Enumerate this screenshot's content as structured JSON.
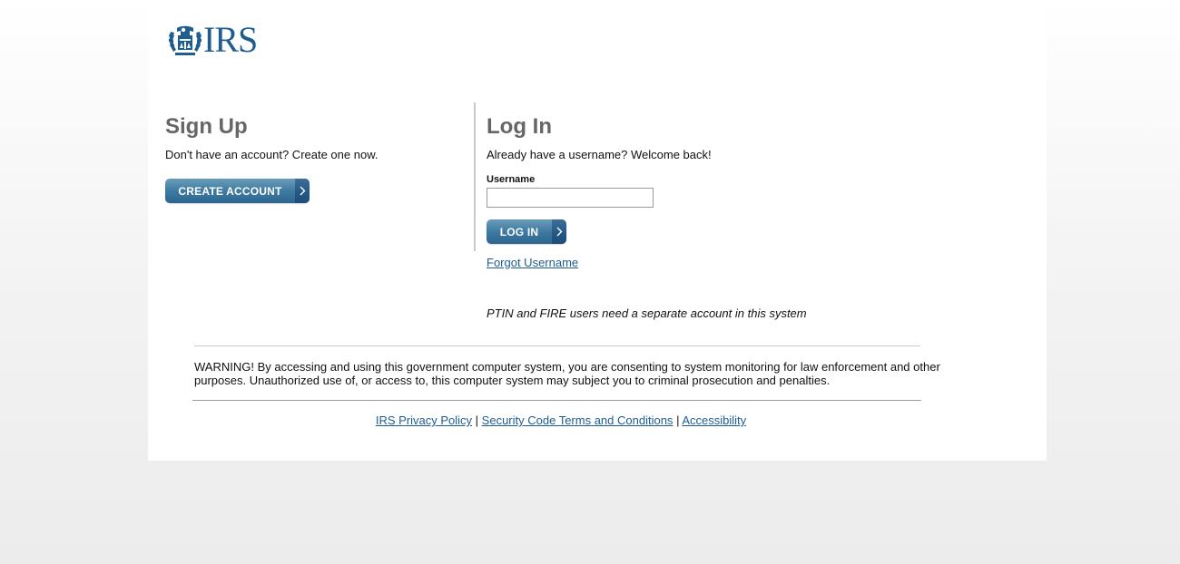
{
  "header": {
    "logo_text": "IRS",
    "logo_icon": "irs-eagle-seal-icon",
    "brand_color": "#1f5d91"
  },
  "signup": {
    "title": "Sign Up",
    "description": "Don't have an account? Create one now.",
    "button_label": "CREATE ACCOUNT",
    "button_icon": "chevron-right-icon"
  },
  "login": {
    "title": "Log In",
    "description": "Already have a username? Welcome back!",
    "username_label": "Username",
    "username_value": "",
    "username_placeholder": "",
    "button_label": "LOG IN",
    "button_icon": "chevron-right-icon",
    "forgot_link": "Forgot Username",
    "ptin_note": "PTIN and FIRE users need a separate account in this system"
  },
  "warning": {
    "text": "WARNING! By accessing and using this government computer system, you are consenting to system monitoring for law enforcement and other purposes. Unauthorized use of, or access to, this computer system may subject you to criminal prosecution and penalties."
  },
  "footer": {
    "links": [
      {
        "label": "IRS Privacy Policy"
      },
      {
        "label": "Security Code Terms and Conditions"
      },
      {
        "label": "Accessibility"
      }
    ],
    "separator": "|"
  },
  "colors": {
    "heading": "#666666",
    "link": "#1f5d91",
    "button_top": "#6a9dba",
    "button_bottom": "#2c6690"
  }
}
